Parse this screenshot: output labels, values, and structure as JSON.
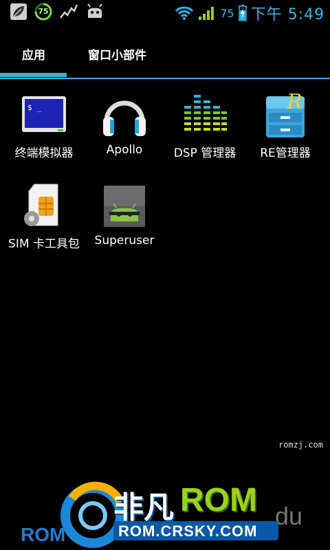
{
  "status": {
    "time": "下午 5:49",
    "battery_percent": "75",
    "gauge_value": "75",
    "accent": "#33b5e5"
  },
  "tabs": [
    {
      "label": "应用"
    },
    {
      "label": "窗口小部件"
    }
  ],
  "apps": [
    {
      "label": "终端模拟器",
      "icon": "terminal-icon"
    },
    {
      "label": "Apollo",
      "icon": "headphones-icon"
    },
    {
      "label": "DSP 管理器",
      "icon": "equalizer-icon"
    },
    {
      "label": "RE管理器",
      "icon": "file-cabinet-icon"
    },
    {
      "label": "SIM 卡工具包",
      "icon": "sim-card-icon"
    },
    {
      "label": "Superuser",
      "icon": "android-superuser-icon"
    }
  ],
  "watermark": {
    "site_small": "romzj.com",
    "brand_cn": "非凡",
    "brand_rom": "ROM",
    "url": "ROM.CRSKY.COM",
    "left_text": "ROM",
    "right_text": "du"
  }
}
